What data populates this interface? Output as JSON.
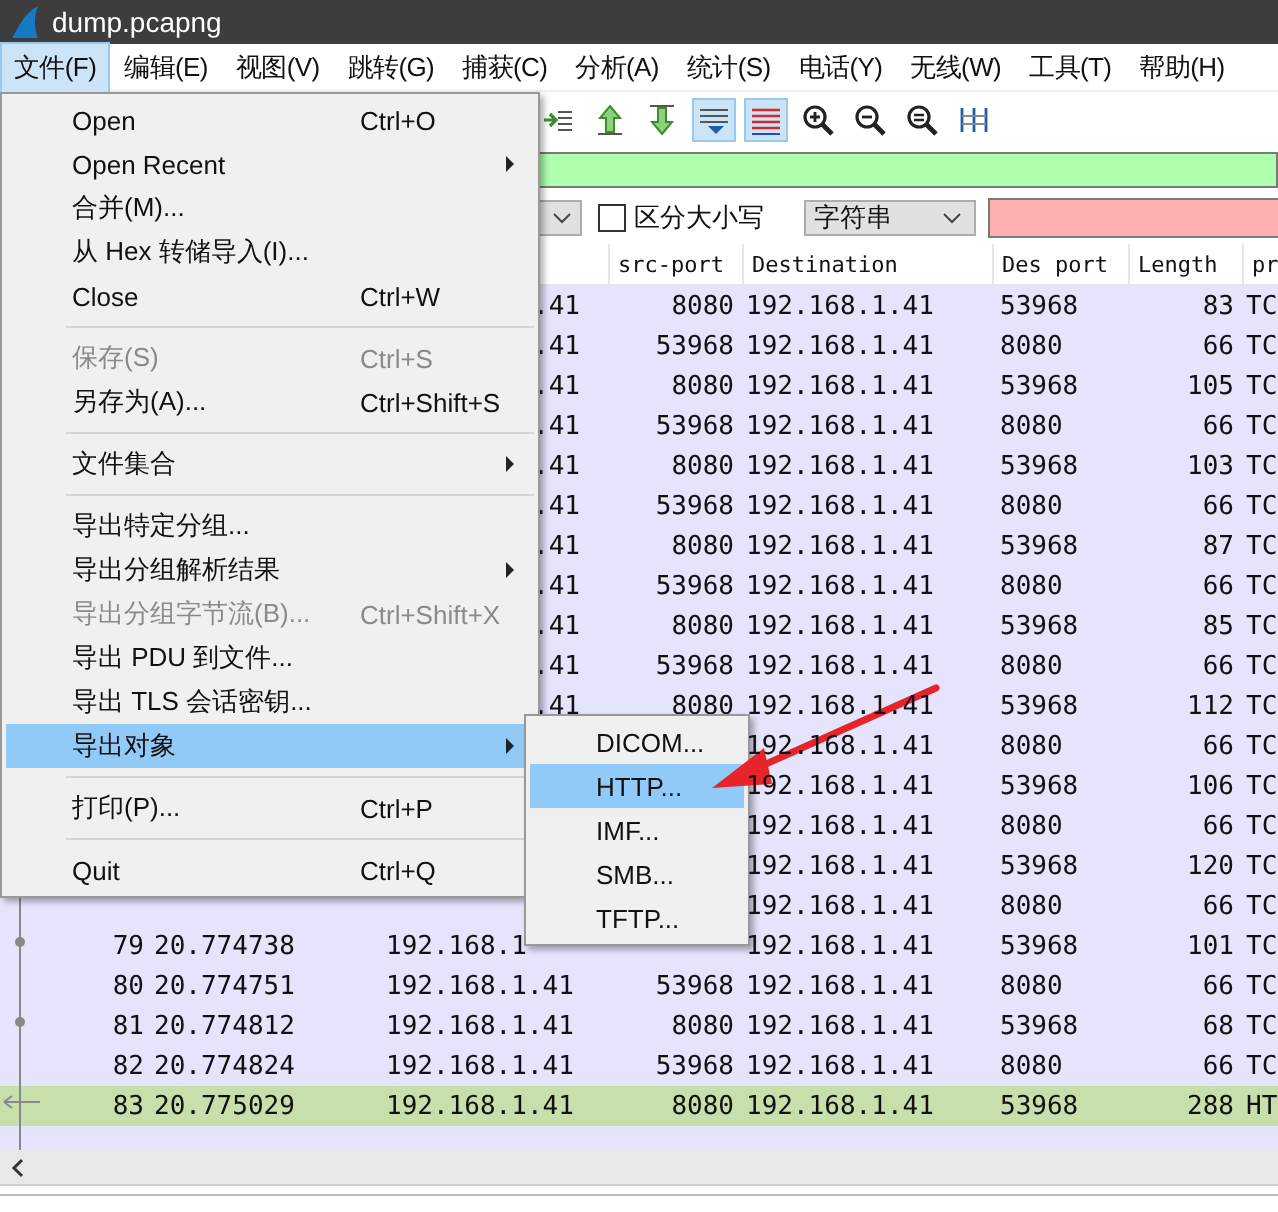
{
  "window": {
    "title": "dump.pcapng"
  },
  "menubar": [
    {
      "label": "文件(F)",
      "selected": true
    },
    {
      "label": "编辑(E)",
      "selected": false
    },
    {
      "label": "视图(V)",
      "selected": false
    },
    {
      "label": "跳转(G)",
      "selected": false
    },
    {
      "label": "捕获(C)",
      "selected": false
    },
    {
      "label": "分析(A)",
      "selected": false
    },
    {
      "label": "统计(S)",
      "selected": false
    },
    {
      "label": "电话(Y)",
      "selected": false
    },
    {
      "label": "无线(W)",
      "selected": false
    },
    {
      "label": "工具(T)",
      "selected": false
    },
    {
      "label": "帮助(H)",
      "selected": false
    }
  ],
  "toolbar": [
    {
      "kind": "goto",
      "active": false
    },
    {
      "kind": "up",
      "active": false
    },
    {
      "kind": "down",
      "active": false
    },
    {
      "kind": "autoscroll",
      "active": true
    },
    {
      "kind": "colorize",
      "active": true
    },
    {
      "kind": "zoom-in",
      "active": false
    },
    {
      "kind": "zoom-out",
      "active": false
    },
    {
      "kind": "zoom-reset",
      "active": false
    },
    {
      "kind": "resize",
      "active": false
    }
  ],
  "display_filter": {
    "valid": true
  },
  "search": {
    "case_sensitive": {
      "label": "区分大小写",
      "checked": false
    },
    "type": "字符串",
    "field_invalid": true
  },
  "table": {
    "columns": [
      "src-port",
      "Destination",
      "Des port",
      "Length",
      "pr"
    ],
    "rows": [
      {
        "source": ".41",
        "src_port": "8080",
        "destination": "192.168.1.41",
        "des_port": "53968",
        "length": "83",
        "protocol": "TC",
        "color": "#e4e4fc"
      },
      {
        "source": ".41",
        "src_port": "53968",
        "destination": "192.168.1.41",
        "des_port": "8080",
        "length": "66",
        "protocol": "TC",
        "color": "#e4e4fc"
      },
      {
        "source": ".41",
        "src_port": "8080",
        "destination": "192.168.1.41",
        "des_port": "53968",
        "length": "105",
        "protocol": "TC",
        "color": "#e4e4fc"
      },
      {
        "source": ".41",
        "src_port": "53968",
        "destination": "192.168.1.41",
        "des_port": "8080",
        "length": "66",
        "protocol": "TC",
        "color": "#e4e4fc"
      },
      {
        "source": ".41",
        "src_port": "8080",
        "destination": "192.168.1.41",
        "des_port": "53968",
        "length": "103",
        "protocol": "TC",
        "color": "#e4e4fc"
      },
      {
        "source": ".41",
        "src_port": "53968",
        "destination": "192.168.1.41",
        "des_port": "8080",
        "length": "66",
        "protocol": "TC",
        "color": "#e4e4fc"
      },
      {
        "source": ".41",
        "src_port": "8080",
        "destination": "192.168.1.41",
        "des_port": "53968",
        "length": "87",
        "protocol": "TC",
        "color": "#e4e4fc"
      },
      {
        "source": ".41",
        "src_port": "53968",
        "destination": "192.168.1.41",
        "des_port": "8080",
        "length": "66",
        "protocol": "TC",
        "color": "#e4e4fc"
      },
      {
        "source": ".41",
        "src_port": "8080",
        "destination": "192.168.1.41",
        "des_port": "53968",
        "length": "85",
        "protocol": "TC",
        "color": "#e4e4fc"
      },
      {
        "source": ".41",
        "src_port": "53968",
        "destination": "192.168.1.41",
        "des_port": "8080",
        "length": "66",
        "protocol": "TC",
        "color": "#e4e4fc"
      },
      {
        "source": ".41",
        "src_port": "8080",
        "destination": "192.168.1.41",
        "des_port": "53968",
        "length": "112",
        "protocol": "TC",
        "color": "#e4e4fc"
      },
      {
        "destination": "192.168.1.41",
        "des_port": "8080",
        "length": "66",
        "protocol": "TC",
        "color": "#e4e4fc"
      },
      {
        "destination": "192.168.1.41",
        "des_port": "53968",
        "length": "106",
        "protocol": "TC",
        "color": "#e4e4fc"
      },
      {
        "destination": "192.168.1.41",
        "des_port": "8080",
        "length": "66",
        "protocol": "TC",
        "color": "#e4e4fc"
      },
      {
        "destination": "192.168.1.41",
        "des_port": "53968",
        "length": "120",
        "protocol": "TC",
        "color": "#e4e4fc"
      },
      {
        "destination": "192.168.1.41",
        "des_port": "8080",
        "length": "66",
        "protocol": "TC",
        "color": "#e4e4fc"
      },
      {
        "no": "79",
        "time": "20.774738",
        "source": "192.168.1",
        "destination": "192.168.1.41",
        "des_port": "53968",
        "length": "101",
        "protocol": "TC",
        "color": "#e4e4fc"
      },
      {
        "no": "80",
        "time": "20.774751",
        "source": "192.168.1.41",
        "src_port": "53968",
        "destination": "192.168.1.41",
        "des_port": "8080",
        "length": "66",
        "protocol": "TC",
        "color": "#e4e4fc"
      },
      {
        "no": "81",
        "time": "20.774812",
        "source": "192.168.1.41",
        "src_port": "8080",
        "destination": "192.168.1.41",
        "des_port": "53968",
        "length": "68",
        "protocol": "TC",
        "color": "#e4e4fc"
      },
      {
        "no": "82",
        "time": "20.774824",
        "source": "192.168.1.41",
        "src_port": "53968",
        "destination": "192.168.1.41",
        "des_port": "8080",
        "length": "66",
        "protocol": "TC",
        "color": "#e4e4fc"
      },
      {
        "no": "83",
        "time": "20.775029",
        "source": "192.168.1.41",
        "src_port": "8080",
        "destination": "192.168.1.41",
        "des_port": "53968",
        "length": "288",
        "protocol": "HT",
        "color": "#c6dfab"
      }
    ]
  },
  "file_menu": [
    {
      "kind": "item",
      "label": "Open",
      "shortcut": "Ctrl+O",
      "disabled": false,
      "selected": false,
      "submenu": false
    },
    {
      "kind": "item",
      "label": "Open Recent",
      "disabled": false,
      "selected": false,
      "submenu": true
    },
    {
      "kind": "item",
      "label": "合并(M)...",
      "disabled": false,
      "selected": false,
      "submenu": false
    },
    {
      "kind": "item",
      "label": "从 Hex 转储导入(I)...",
      "disabled": false,
      "selected": false,
      "submenu": false
    },
    {
      "kind": "item",
      "label": "Close",
      "shortcut": "Ctrl+W",
      "disabled": false,
      "selected": false,
      "submenu": false
    },
    {
      "kind": "separator"
    },
    {
      "kind": "item",
      "label": "保存(S)",
      "shortcut": "Ctrl+S",
      "disabled": true,
      "selected": false,
      "submenu": false
    },
    {
      "kind": "item",
      "label": "另存为(A)...",
      "shortcut": "Ctrl+Shift+S",
      "disabled": false,
      "selected": false,
      "submenu": false
    },
    {
      "kind": "separator"
    },
    {
      "kind": "item",
      "label": "文件集合",
      "disabled": false,
      "selected": false,
      "submenu": true
    },
    {
      "kind": "separator"
    },
    {
      "kind": "item",
      "label": "导出特定分组...",
      "disabled": false,
      "selected": false,
      "submenu": false
    },
    {
      "kind": "item",
      "label": "导出分组解析结果",
      "disabled": false,
      "selected": false,
      "submenu": true
    },
    {
      "kind": "item",
      "label": "导出分组字节流(B)...",
      "shortcut": "Ctrl+Shift+X",
      "disabled": true,
      "selected": false,
      "submenu": false
    },
    {
      "kind": "item",
      "label": "导出 PDU 到文件...",
      "disabled": false,
      "selected": false,
      "submenu": false
    },
    {
      "kind": "item",
      "label": "导出 TLS 会话密钥...",
      "disabled": false,
      "selected": false,
      "submenu": false
    },
    {
      "kind": "item",
      "label": "导出对象",
      "disabled": false,
      "selected": true,
      "submenu": true
    },
    {
      "kind": "separator"
    },
    {
      "kind": "item",
      "label": "打印(P)...",
      "shortcut": "Ctrl+P",
      "disabled": false,
      "selected": false,
      "submenu": false
    },
    {
      "kind": "separator"
    },
    {
      "kind": "item",
      "label": "Quit",
      "shortcut": "Ctrl+Q",
      "disabled": false,
      "selected": false,
      "submenu": false
    }
  ],
  "export_objects_menu": [
    {
      "label": "DICOM...",
      "selected": false
    },
    {
      "label": "HTTP...",
      "selected": true
    },
    {
      "label": "IMF...",
      "selected": false
    },
    {
      "label": "SMB...",
      "selected": false
    },
    {
      "label": "TFTP...",
      "selected": false
    }
  ]
}
